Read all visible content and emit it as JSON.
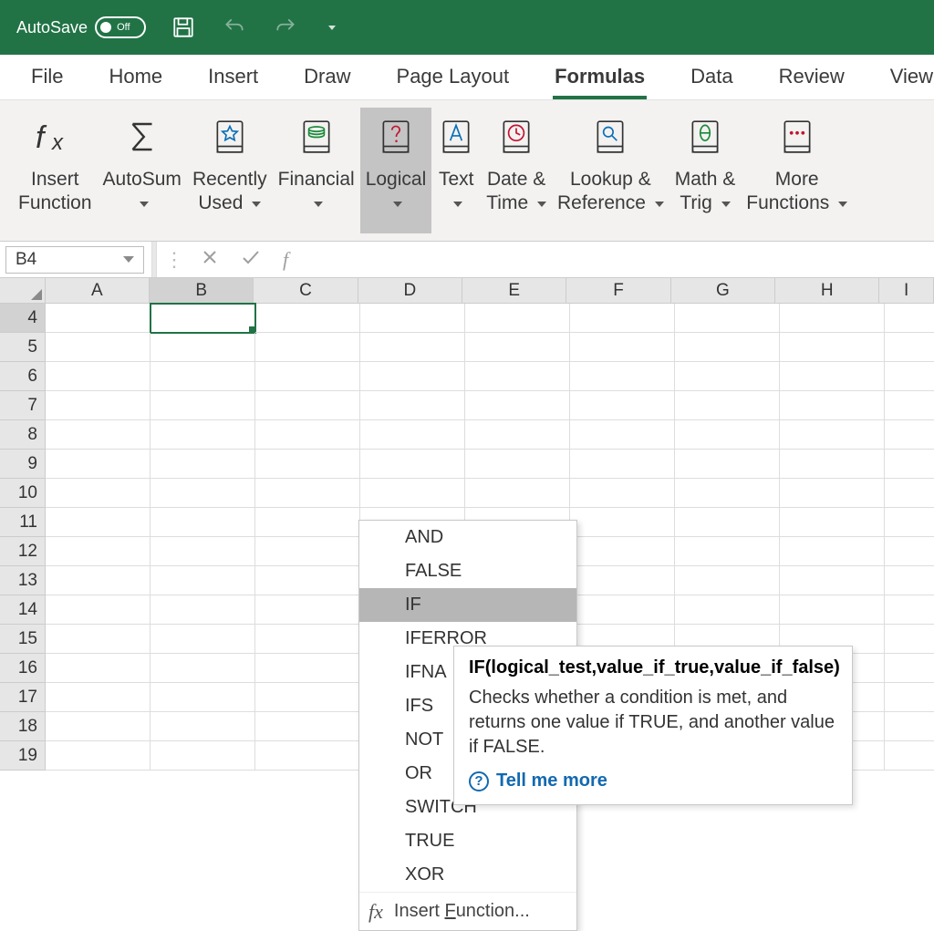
{
  "titlebar": {
    "autosave_label": "AutoSave",
    "autosave_state": "Off"
  },
  "tabs": {
    "file": "File",
    "home": "Home",
    "insert": "Insert",
    "draw": "Draw",
    "page_layout": "Page Layout",
    "formulas": "Formulas",
    "data": "Data",
    "review": "Review",
    "view": "View"
  },
  "ribbon": {
    "insert_function": "Insert\nFunction",
    "autosum": "AutoSum",
    "recently_used": "Recently\nUsed",
    "financial": "Financial",
    "logical": "Logical",
    "text": "Text",
    "date_time": "Date &\nTime",
    "lookup_reference": "Lookup &\nReference",
    "math_trig": "Math &\nTrig",
    "more_functions": "More\nFunctions"
  },
  "formula_bar": {
    "name_box": "B4",
    "formula": ""
  },
  "grid": {
    "columns": [
      "A",
      "B",
      "C",
      "D",
      "E",
      "F",
      "G",
      "H",
      "I"
    ],
    "rows": [
      4,
      5,
      6,
      7,
      8,
      9,
      10,
      11,
      12,
      13,
      14,
      15,
      16,
      17,
      18,
      19
    ],
    "selected_cell": "B4"
  },
  "dropdown": {
    "items": [
      "AND",
      "FALSE",
      "IF",
      "IFERROR",
      "IFNA",
      "IFS",
      "NOT",
      "OR",
      "SWITCH",
      "TRUE",
      "XOR"
    ],
    "highlighted": "IF",
    "insert_function": "Insert Function..."
  },
  "tooltip": {
    "title": "IF(logical_test,value_if_true,value_if_false)",
    "body": "Checks whether a condition is met, and returns one value if TRUE, and another value if FALSE.",
    "link": "Tell me more"
  }
}
